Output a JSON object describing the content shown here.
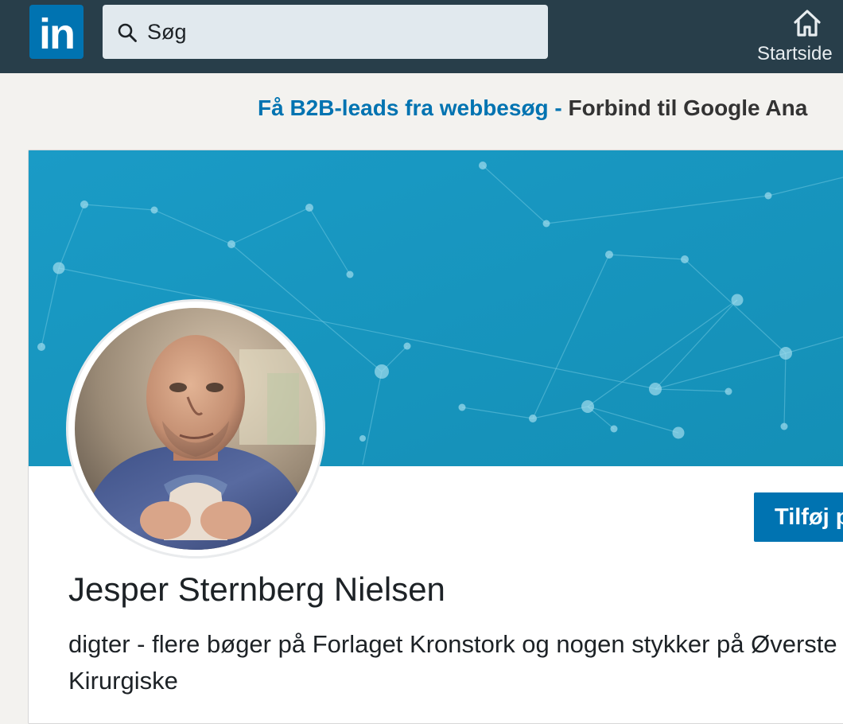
{
  "topbar": {
    "logo_text": "in",
    "search": {
      "value": "Søg",
      "icon": "search-icon"
    },
    "nav": [
      {
        "label": "Startside",
        "icon": "home-icon"
      }
    ],
    "background_color": "#283e4a",
    "brand_color": "#0073b1"
  },
  "ad_banner": {
    "link_text": "Få B2B-leads fra webbesøg",
    "separator": " - ",
    "rest_text": "Forbind til Google Ana"
  },
  "profile": {
    "cover_color": "#1496c0",
    "add_button_label": "Tilføj p",
    "name": "Jesper Sternberg Nielsen",
    "headline": "digter - flere bøger på Forlaget Kronstork og nogen stykker på Øverste Kirurgiske"
  }
}
